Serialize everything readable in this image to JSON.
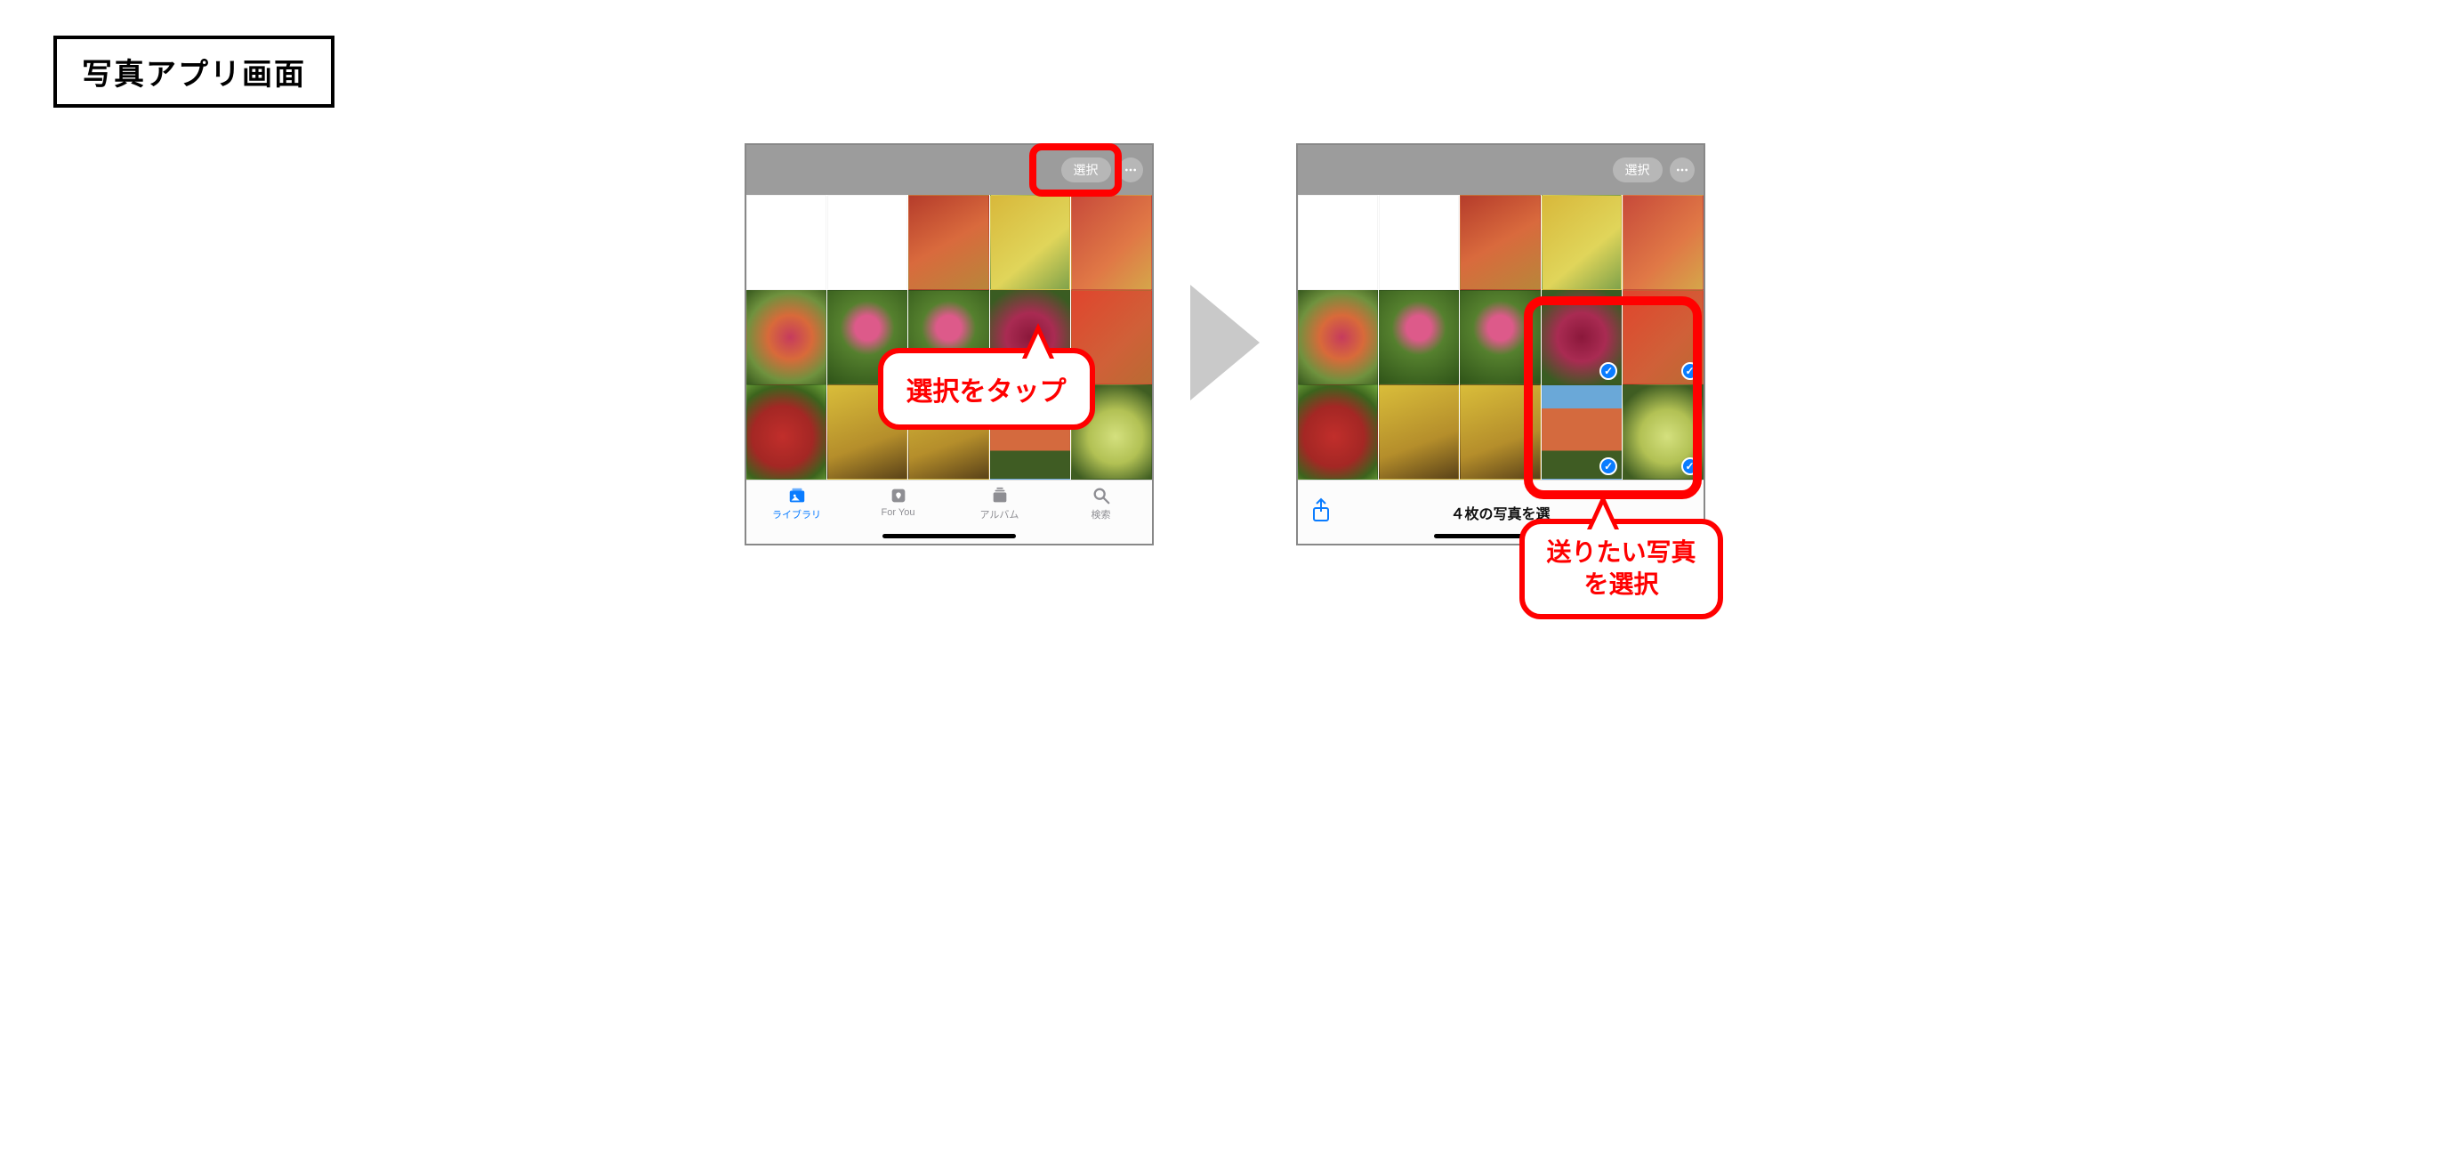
{
  "title": "写真アプリ画面",
  "left": {
    "select_btn": "選択",
    "tabs": {
      "library": "ライブラリ",
      "foryou": "For You",
      "albums": "アルバム",
      "search": "検索"
    }
  },
  "right": {
    "select_btn": "選択",
    "status": "４枚の写真を選"
  },
  "annotations": {
    "tap_select": "選択をタップ",
    "pick_photos_l1": "送りたい写真",
    "pick_photos_l2": "を選択"
  }
}
